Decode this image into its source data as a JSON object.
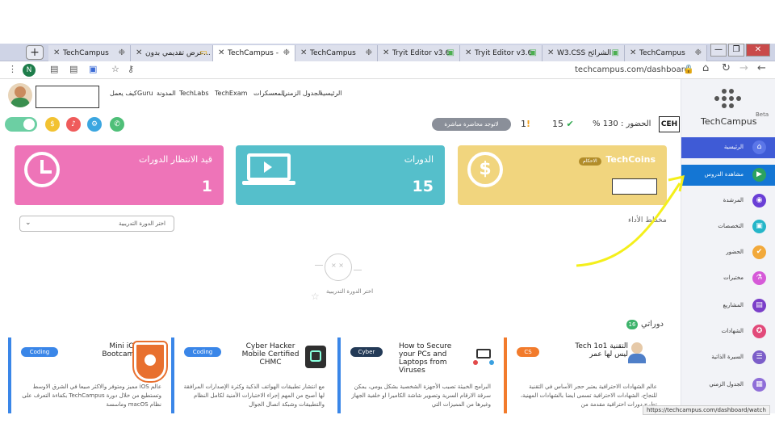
{
  "browser": {
    "new_tab": "+",
    "tabs": [
      {
        "label": "TechCampus",
        "active": false
      },
      {
        "label": "عرض تقديمي بدون...",
        "active": false
      },
      {
        "label": "TechCampus -",
        "active": true
      },
      {
        "label": "TechCampus",
        "active": false
      },
      {
        "label": "Tryit Editor v3.6",
        "active": false
      },
      {
        "label": "Tryit Editor v3.6",
        "active": false
      },
      {
        "label": "W3.CSS الشرائح",
        "active": false
      },
      {
        "label": "TechCampus",
        "active": false
      }
    ],
    "url": "techcampus.com/dashboard",
    "profile_initial": "N",
    "status_url": "https://techcampus.com/dashboard/watch"
  },
  "sidebar": {
    "brand": "TechCampus",
    "beta": "Beta",
    "items": [
      {
        "label": "الرئيسية",
        "icon": "home-icon",
        "color": "#3f5bd6"
      },
      {
        "label": "مشاهدة الدروس",
        "icon": "video-icon",
        "color": "#2ca25f"
      },
      {
        "label": "المرشدة",
        "icon": "mentor-icon",
        "color": "#6a3fd6"
      },
      {
        "label": "التخصصات",
        "icon": "specialization-icon",
        "color": "#26b6c9"
      },
      {
        "label": "الحضور",
        "icon": "attendance-icon",
        "color": "#f2a93b"
      },
      {
        "label": "مختبرات",
        "icon": "lab-icon",
        "color": "#d65ad8"
      },
      {
        "label": "المشاريع",
        "icon": "project-icon",
        "color": "#7b3fc9"
      },
      {
        "label": "الشهادات",
        "icon": "certificate-icon",
        "color": "#e24a7a"
      },
      {
        "label": "السيرة الذاتية",
        "icon": "cv-icon",
        "color": "#7c5ec9"
      },
      {
        "label": "الجدول الزمني",
        "icon": "calendar-icon",
        "color": "#8f6ed8"
      }
    ]
  },
  "topnav": {
    "links": [
      "الرئيسية",
      "الجدول الزمني",
      "المعسكرات",
      "TechExam",
      "TechLabs",
      "المدونة",
      "Guru",
      "كيف يعمل"
    ]
  },
  "status": {
    "attendance_label": "الحضور : 130 %",
    "checks": "15",
    "alerts": "1",
    "live_pill": "لاتوجد محاضرة مباشرة",
    "badge": "CEH"
  },
  "cards": {
    "techcoins": {
      "title": "TechCoins",
      "tag": "الاحكام",
      "color": "#f1d57e"
    },
    "courses": {
      "title": "الدورات",
      "value": "15",
      "color": "#55bfcb"
    },
    "pending": {
      "title": "قيد الانتظار الدورات",
      "value": "1",
      "color": "#ee74b8"
    }
  },
  "schedule": {
    "label": "مخطط الأداء",
    "dropdown": "اختر الدورة التدريبية",
    "empty_text": "اختر الدورة التدريبية"
  },
  "my_courses": {
    "title": "دوراتي",
    "count": "16",
    "items": [
      {
        "tag": "CS",
        "tag_color": "#f27b2c",
        "title": "Tech 1o1 التقنية ليس لها عمر",
        "desc": "عالم الشهادات الاحترافية يعتبر حجر الأساس في التقنية للنجاح، الشهادات الاحترافية تسمى ايضا بالشهادات المهنية، تطرح دورات احترافية مقدمة من"
      },
      {
        "tag": "Cyber",
        "tag_color": "#233a57",
        "title": "How to Secure your PCs and Laptops from Viruses",
        "desc": "البرامج الخبيثة تصيب الأجهزة الشخصية بشكل يومي، يمكن سرقة الارقام السرية وتصوير شاشة الكاميرا او خلفية الجهاز وغيرها من المميزات التي"
      },
      {
        "tag": "Coding",
        "tag_color": "#3a86e8",
        "title": "Cyber Hacker Mobile Certified CHMC",
        "desc": "مع انتشار تطبيقات الهواتف الذكية وكثرة الإصدارات المرافقة لها أصبح من المهم إجراء الاختبارات الأمنية لكامل النظام والتطبيقات وشبكة اتصال الجوال"
      },
      {
        "tag": "Coding",
        "tag_color": "#3a86e8",
        "title": "Mini iOS Bootcamp",
        "desc": "عالم iOS مميز ومتوفر والاكثر مبيعا في الشرق الاوسط وتستطيع من خلال دورة TechCampus بكفاءة التعرف على نظام macOS وماسسة"
      }
    ]
  }
}
